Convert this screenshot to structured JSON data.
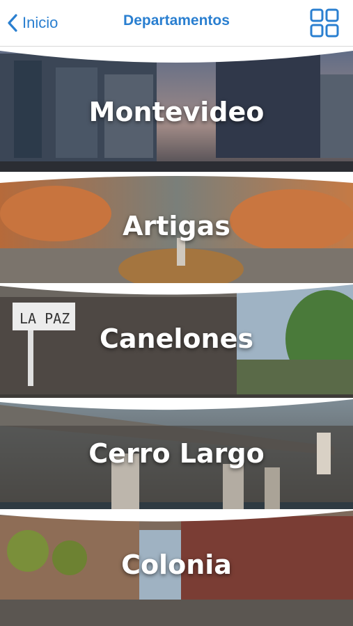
{
  "navbar": {
    "back_label": "Inicio",
    "title": "Departamentos",
    "accent_color": "#2a7fd0",
    "grid_icon": "grid-icon"
  },
  "departments": [
    {
      "name": "Montevideo"
    },
    {
      "name": "Artigas"
    },
    {
      "name": "Canelones"
    },
    {
      "name": "Cerro Largo"
    },
    {
      "name": "Colonia"
    }
  ]
}
